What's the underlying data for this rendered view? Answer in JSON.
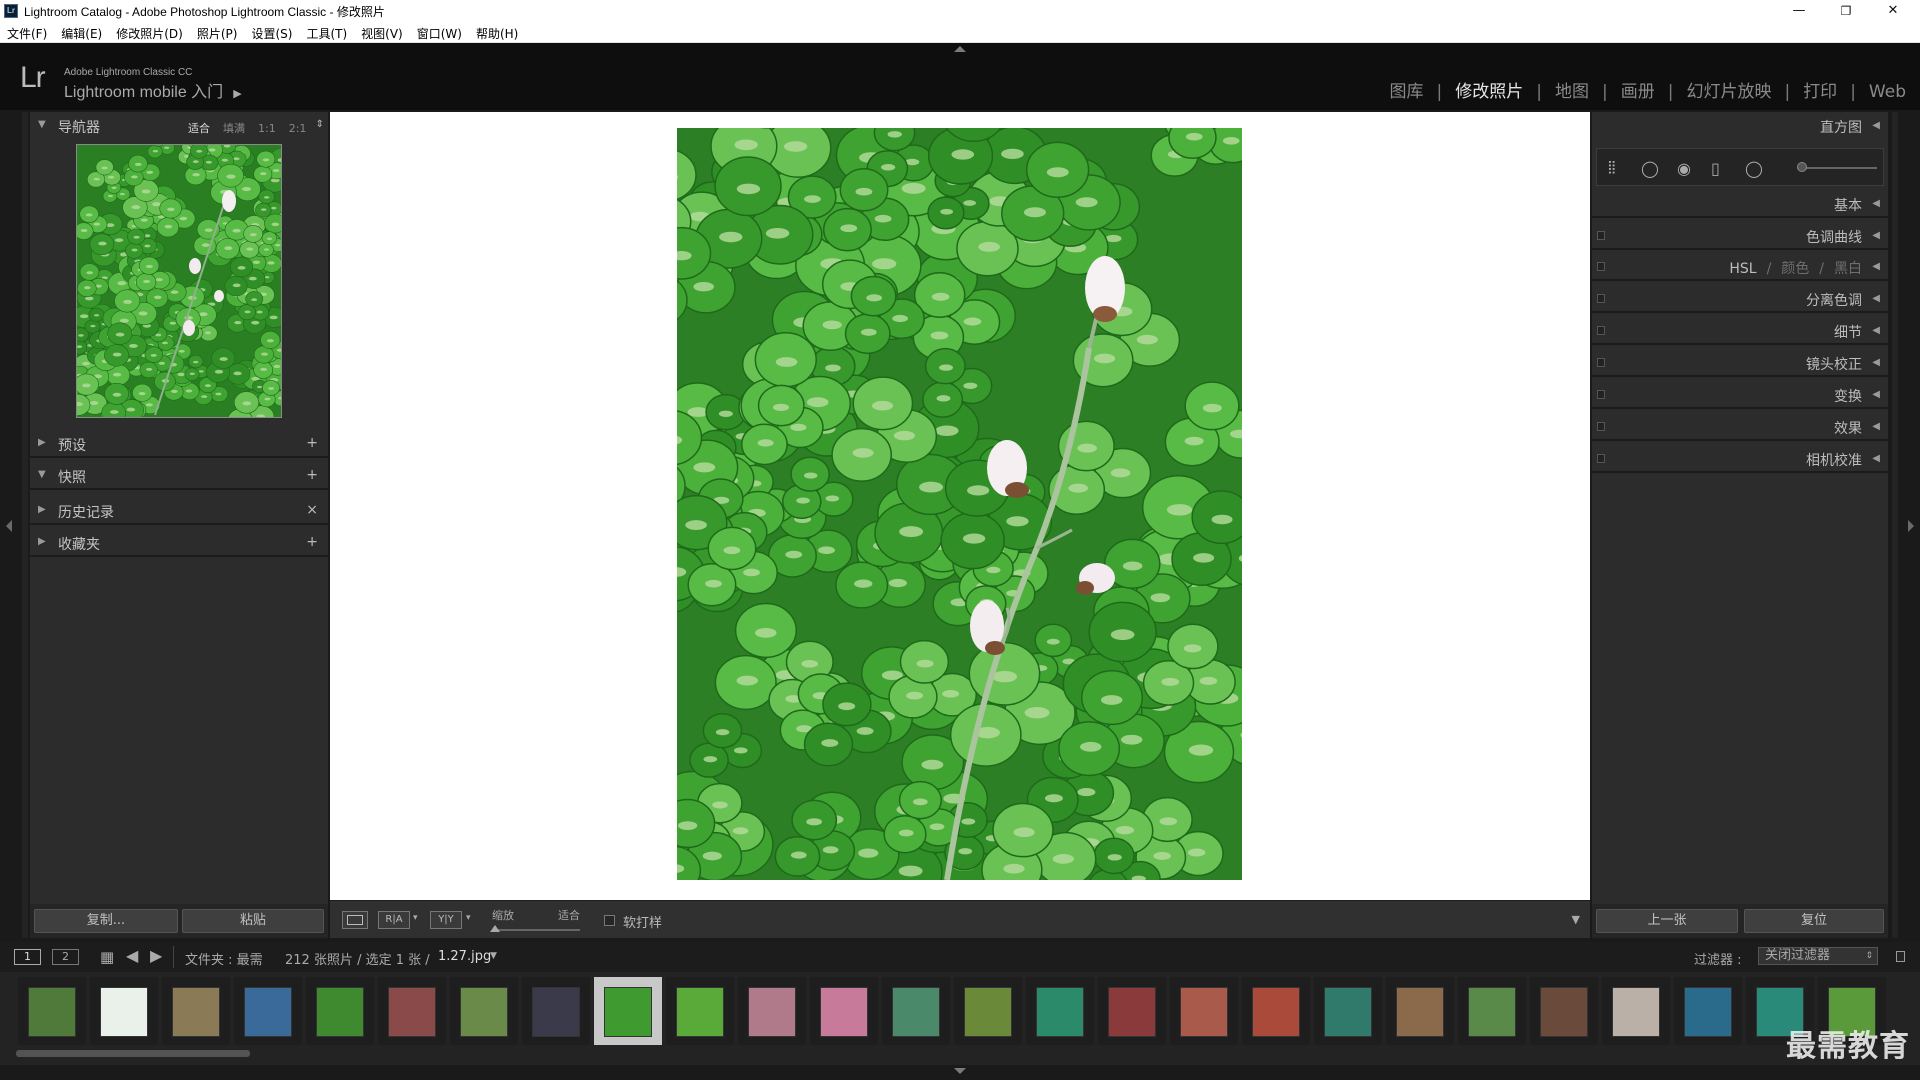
{
  "window": {
    "title": "Lightroom Catalog - Adobe Photoshop Lightroom Classic - 修改照片",
    "app_icon": "Lr",
    "minimize": "—",
    "restore": "❐",
    "close": "✕"
  },
  "menu": [
    "文件(F)",
    "编辑(E)",
    "修改照片(D)",
    "照片(P)",
    "设置(S)",
    "工具(T)",
    "视图(V)",
    "窗口(W)",
    "帮助(H)"
  ],
  "identity": {
    "logo": "Lr",
    "product": "Adobe Lightroom Classic CC",
    "mobile": "Lightroom mobile 入门",
    "mobile_arrow": "▶"
  },
  "modules": [
    {
      "label": "图库",
      "active": false
    },
    {
      "label": "修改照片",
      "active": true
    },
    {
      "label": "地图",
      "active": false
    },
    {
      "label": "画册",
      "active": false
    },
    {
      "label": "幻灯片放映",
      "active": false
    },
    {
      "label": "打印",
      "active": false
    },
    {
      "label": "Web",
      "active": false
    }
  ],
  "module_separator": "|",
  "left_panel": {
    "navigator": {
      "label": "导航器",
      "modes": [
        "适合",
        "填满",
        "1:1",
        "2:1"
      ],
      "selected_mode": "适合",
      "mode_stepper": "⇕"
    },
    "presets": {
      "label": "预设",
      "action": "+"
    },
    "snapshots": {
      "label": "快照",
      "action": "+"
    },
    "history": {
      "label": "历史记录",
      "action": "×"
    },
    "collections": {
      "label": "收藏夹",
      "action": "+"
    },
    "copy_button": "复制...",
    "paste_button": "粘贴"
  },
  "right_panel": {
    "histogram": "直方图",
    "basic": "基本",
    "tone_curve": "色调曲线",
    "hsl": {
      "a": "HSL",
      "sep": "/",
      "b": "颜色",
      "c": "黑白"
    },
    "split_toning": "分离色调",
    "detail": "细节",
    "lens_corrections": "镜头校正",
    "transform": "变换",
    "effects": "效果",
    "camera_calibration": "相机校准",
    "prev_button": "上一张",
    "reset_button": "复位"
  },
  "toolbar": {
    "zoom_label": "缩放",
    "zoom_value": "适合",
    "soft_proof": "软打样"
  },
  "filmstrip": {
    "screen1": "1",
    "screen2": "2",
    "source_prefix": "文件夹 : 最需",
    "count": "212 张照片 / 选定 1 张 /",
    "file": "1.27.jpg",
    "filter_label": "过滤器 :",
    "filter_value": "关闭过滤器",
    "selected_index": 8,
    "thumb_count": 26
  },
  "watermark": "最需教育",
  "colors": {
    "accent_active": "#e6e6e6",
    "panel_bg": "#2c2c2c",
    "leaf_green": "#2f8a27"
  }
}
